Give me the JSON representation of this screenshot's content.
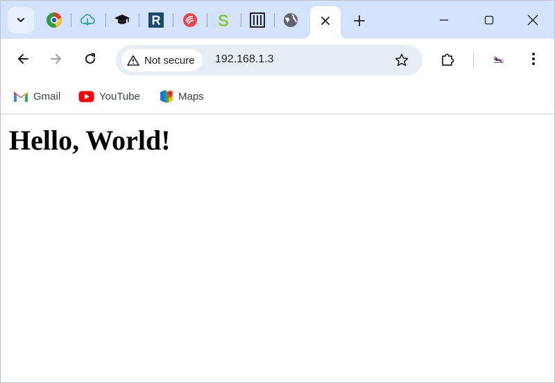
{
  "tabstrip": {
    "tab_icons": [
      "chrome-color-icon",
      "cloud-download-icon",
      "graduation-cap-icon",
      "r-logo-icon",
      "fingerprint-logo-icon",
      "s-logo-icon",
      "wokwi-logo-icon",
      "globe-icon"
    ],
    "active_tab_icon": "close-icon",
    "colors": {
      "strip": "#d3e3fd",
      "active_tab": "#ffffff"
    }
  },
  "toolbar": {
    "security_label": "Not secure",
    "url": "192.168.1.3"
  },
  "bookmarks": [
    {
      "label": "Gmail",
      "icon": "gmail-icon"
    },
    {
      "label": "YouTube",
      "icon": "youtube-icon"
    },
    {
      "label": "Maps",
      "icon": "maps-icon"
    }
  ],
  "page": {
    "heading": "Hello, World!"
  }
}
